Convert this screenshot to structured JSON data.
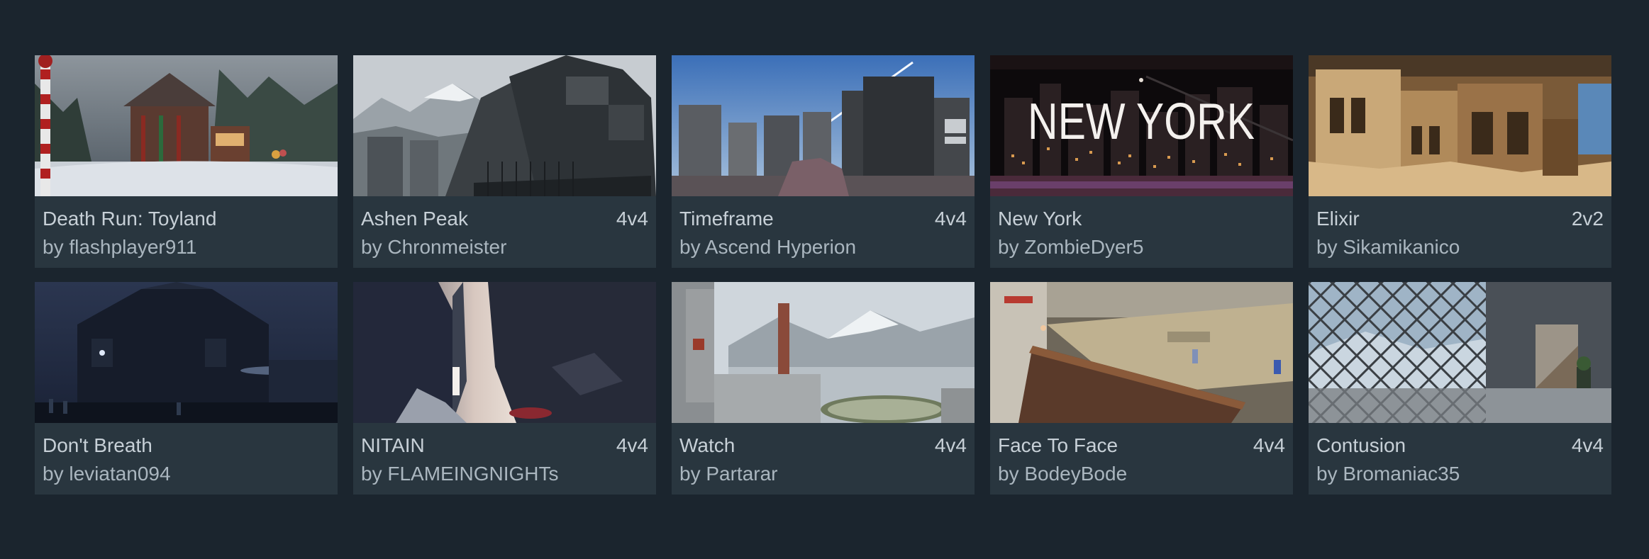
{
  "maps": [
    {
      "title": "Death Run: Toyland",
      "author": "by flashplayer911",
      "mode": ""
    },
    {
      "title": "Ashen Peak",
      "author": "by Chronmeister",
      "mode": "4v4"
    },
    {
      "title": "Timeframe",
      "author": "by Ascend Hyperion",
      "mode": "4v4"
    },
    {
      "title": "New York",
      "author": "by ZombieDyer5",
      "mode": "",
      "thumb_text": "NEW YORK"
    },
    {
      "title": "Elixir",
      "author": "by Sikamikanico",
      "mode": "2v2"
    },
    {
      "title": "Don't Breath",
      "author": "by leviatan094",
      "mode": ""
    },
    {
      "title": "NITAIN",
      "author": "by FLAMEINGNIGHTs",
      "mode": "4v4"
    },
    {
      "title": "Watch",
      "author": "by Partarar",
      "mode": "4v4"
    },
    {
      "title": "Face To Face",
      "author": "by BodeyBode",
      "mode": "4v4"
    },
    {
      "title": "Contusion",
      "author": "by Bromaniac35",
      "mode": "4v4"
    }
  ],
  "colors": {
    "background": "#1b252e",
    "card": "#29363f",
    "title_text": "#c7d0d7",
    "author_text": "#aab6bf"
  }
}
